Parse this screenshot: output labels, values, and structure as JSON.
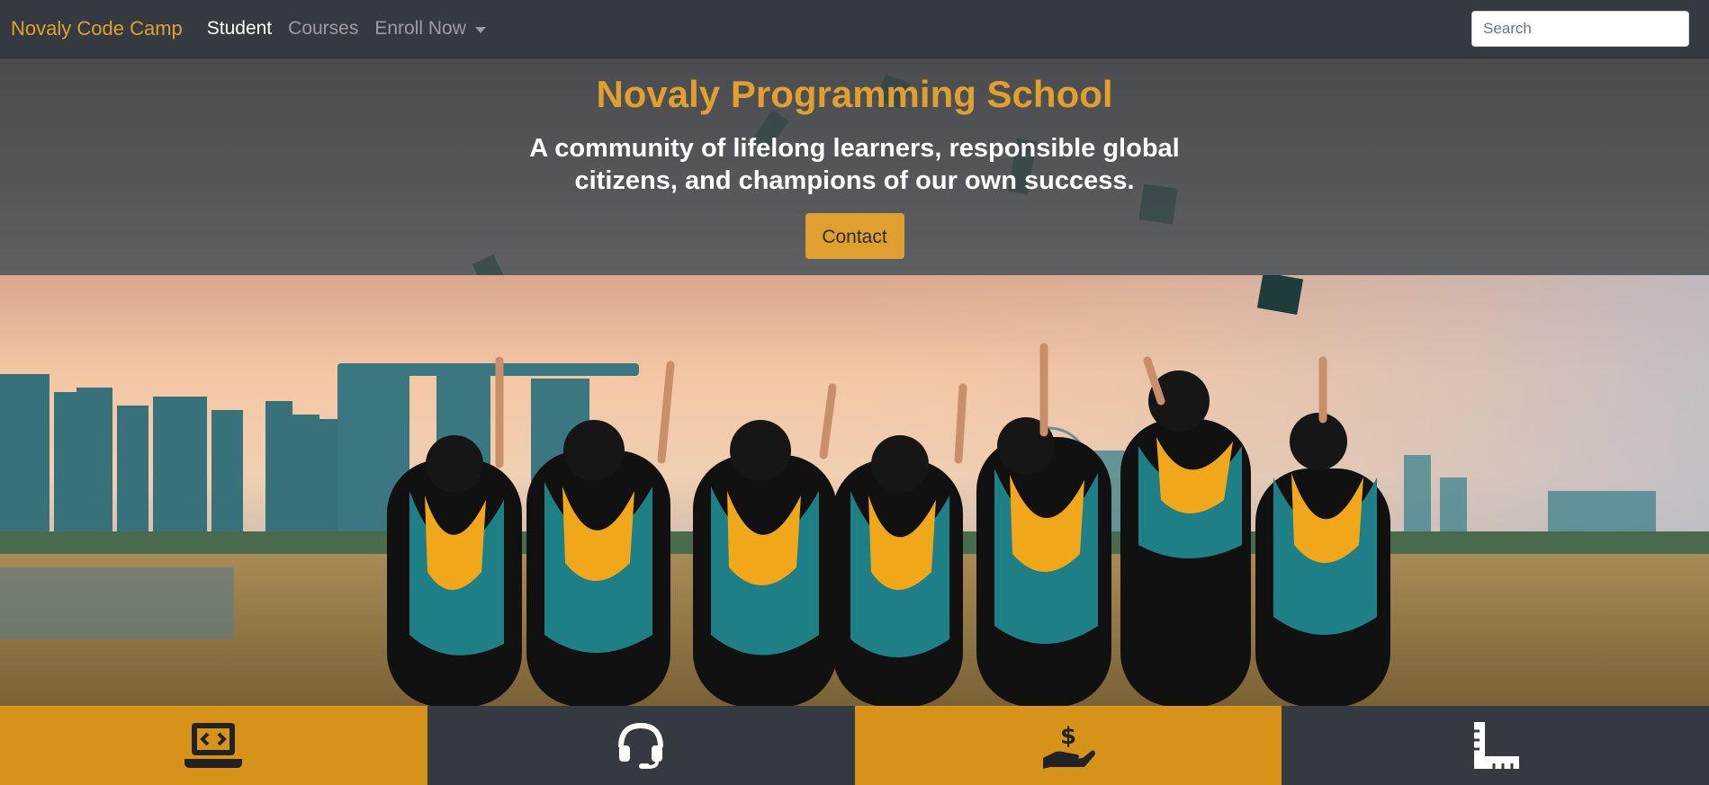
{
  "navbar": {
    "brand": "Novaly Code Camp",
    "links": [
      {
        "label": "Student",
        "active": true
      },
      {
        "label": "Courses",
        "active": false
      },
      {
        "label": "Enroll Now",
        "dropdown": true
      }
    ],
    "search_placeholder": "Search"
  },
  "hero": {
    "title": "Novaly Programming School",
    "subtitle": "A community of lifelong learners, responsible global citizens, and champions of our own success.",
    "button_label": "Contact"
  },
  "colors": {
    "accent": "#e0a030",
    "nav_bg": "#343a40",
    "feature_gold": "#d79319",
    "feature_dark": "#343a40"
  },
  "features": [
    {
      "icon": "laptop-code-icon",
      "style": "gold"
    },
    {
      "icon": "headset-icon",
      "style": "dark"
    },
    {
      "icon": "hand-dollar-icon",
      "style": "gold"
    },
    {
      "icon": "ruler-icon",
      "style": "dark"
    }
  ]
}
